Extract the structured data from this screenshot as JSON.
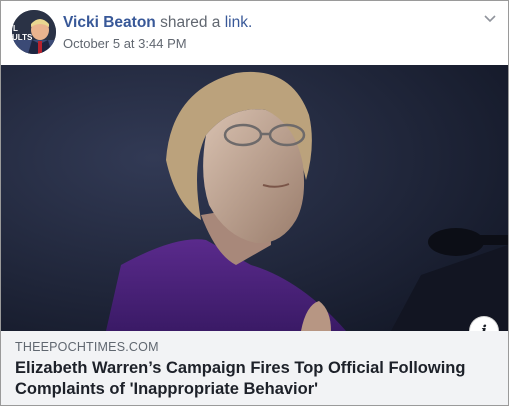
{
  "post": {
    "author": "Vicki Beaton",
    "action_text": "shared a",
    "link_word": "link.",
    "timestamp": "October 5 at 3:44 PM"
  },
  "avatar": {
    "text_fragment_1": "L",
    "text_fragment_2": "ULTS"
  },
  "link_preview": {
    "domain": "THEEPOCHTIMES.COM",
    "headline": "Elizabeth Warren’s Campaign Fires Top Official Following Complaints of 'Inappropriate Behavior'"
  },
  "icons": {
    "menu": "chevron-down-icon",
    "info": "info-icon",
    "info_glyph": "i"
  },
  "colors": {
    "link_blue": "#385898",
    "caption_bg": "#f2f3f5",
    "photo_bg": "#1f2436"
  }
}
